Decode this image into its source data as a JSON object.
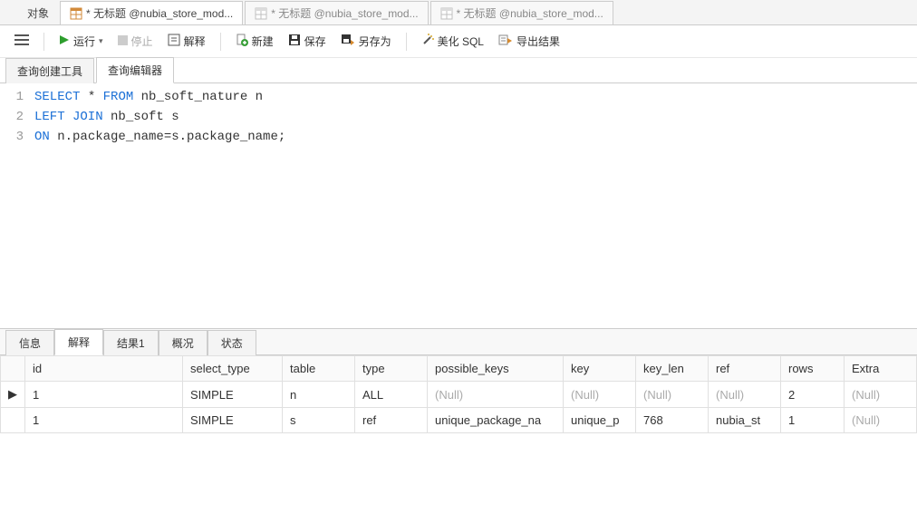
{
  "top_tabs": {
    "objects": "对象",
    "active": "* 无标题 @nubia_store_mod...",
    "dim1": "* 无标题 @nubia_store_mod...",
    "dim2": "* 无标题 @nubia_store_mod..."
  },
  "toolbar": {
    "run": "运行",
    "stop": "停止",
    "explain": "解释",
    "new": "新建",
    "save": "保存",
    "saveas": "另存为",
    "beautify": "美化 SQL",
    "export": "导出结果"
  },
  "sub_tabs": {
    "builder": "查询创建工具",
    "editor": "查询编辑器"
  },
  "sql": {
    "l1": {
      "a": "SELECT",
      "b": " * ",
      "c": "FROM",
      "d": " nb_soft_nature n"
    },
    "l2": {
      "a": "LEFT JOIN",
      "b": " nb_soft s"
    },
    "l3": {
      "a": "ON",
      "b": " n.package_name=s.package_name;"
    }
  },
  "result_tabs": {
    "info": "信息",
    "explain": "解释",
    "result1": "结果1",
    "overview": "概况",
    "status": "状态"
  },
  "grid": {
    "headers": [
      "id",
      "select_type",
      "table",
      "type",
      "possible_keys",
      "key",
      "key_len",
      "ref",
      "rows",
      "Extra"
    ],
    "rows": [
      {
        "indicator": "▶",
        "cells": [
          "1",
          "SIMPLE",
          "n",
          "ALL",
          "(Null)",
          "(Null)",
          "(Null)",
          "(Null)",
          "2",
          "(Null)"
        ],
        "nulls": [
          false,
          false,
          false,
          false,
          true,
          true,
          true,
          true,
          false,
          true
        ]
      },
      {
        "indicator": "",
        "cells": [
          "1",
          "SIMPLE",
          "s",
          "ref",
          "unique_package_na",
          "unique_p",
          "768",
          "nubia_st",
          "1",
          "(Null)"
        ],
        "nulls": [
          false,
          false,
          false,
          false,
          false,
          false,
          false,
          false,
          false,
          true
        ]
      }
    ]
  },
  "colors": {
    "keyword": "#1a6fd6",
    "null": "#aaa"
  }
}
